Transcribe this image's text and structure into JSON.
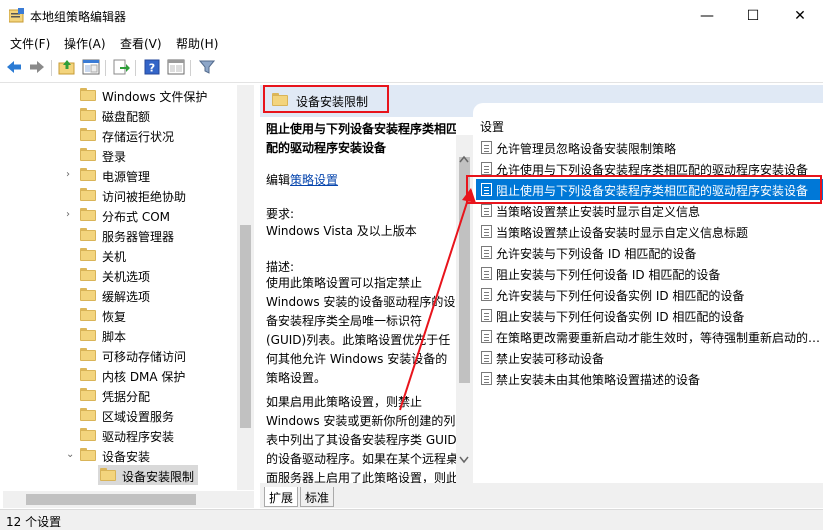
{
  "window": {
    "title": "本地组策略编辑器",
    "minimize_glyph": "—",
    "maximize_glyph": "☐",
    "close_glyph": "✕"
  },
  "menu": {
    "file": "文件(F)",
    "action": "操作(A)",
    "view": "查看(V)",
    "help": "帮助(H)"
  },
  "toolbar": {
    "icons": [
      "back-arrow-icon",
      "forward-arrow-icon",
      "up-folder-icon",
      "show-hide-tree-icon",
      "export-list-icon",
      "help-icon",
      "properties-icon",
      "filter-icon"
    ]
  },
  "tree": {
    "items": [
      {
        "label": "Windows 文件保护",
        "expandable": false
      },
      {
        "label": "磁盘配额",
        "expandable": false
      },
      {
        "label": "存储运行状况",
        "expandable": false
      },
      {
        "label": "登录",
        "expandable": false
      },
      {
        "label": "电源管理",
        "expandable": true
      },
      {
        "label": "访问被拒绝协助",
        "expandable": false
      },
      {
        "label": "分布式 COM",
        "expandable": true
      },
      {
        "label": "服务器管理器",
        "expandable": false
      },
      {
        "label": "关机",
        "expandable": false
      },
      {
        "label": "关机选项",
        "expandable": false
      },
      {
        "label": "缓解选项",
        "expandable": false
      },
      {
        "label": "恢复",
        "expandable": false
      },
      {
        "label": "脚本",
        "expandable": false
      },
      {
        "label": "可移动存储访问",
        "expandable": false
      },
      {
        "label": "内核 DMA 保护",
        "expandable": false
      },
      {
        "label": "凭据分配",
        "expandable": false
      },
      {
        "label": "区域设置服务",
        "expandable": false
      },
      {
        "label": "驱动程序安装",
        "expandable": false
      },
      {
        "label": "设备安装",
        "expandable": true,
        "expanded": true
      },
      {
        "label": "设备安装限制",
        "expandable": false,
        "selected": true
      }
    ]
  },
  "right": {
    "header_label": "设备安装限制",
    "description": {
      "title": "阻止使用与下列设备安装程序类相匹配的驱动程序安装设备",
      "edit_prefix": "编辑",
      "edit_link": "策略设置",
      "requirements_label": "要求:",
      "requirements_value": "Windows Vista 及以上版本",
      "desc_label": "描述:",
      "desc_text": "使用此策略设置可以指定禁止 Windows 安装的设备驱动程序的设备安装程序类全局唯一标识符(GUID)列表。此策略设置优先于任何其他允许 Windows 安装设备的策略设置。",
      "desc_text2": "如果启用此策略设置，则禁止 Windows 安装或更新你所创建的列表中列出了其设备安装程序类 GUID 的设备驱动程序。如果在某个远程桌面服务器上启用了此策略设置，则此策略设置会影响指定设"
    },
    "list_header": "设置",
    "list_items": [
      "允许管理员忽略设备安装限制策略",
      "允许使用与下列设备安装程序类相匹配的驱动程序安装设备",
      "阻止使用与下列设备安装程序类相匹配的驱动程序安装设备",
      "当策略设置禁止安装时显示自定义信息",
      "当策略设置禁止设备安装时显示自定义信息标题",
      "允许安装与下列设备 ID 相匹配的设备",
      "阻止安装与下列任何设备 ID 相匹配的设备",
      "允许安装与下列任何设备实例 ID 相匹配的设备",
      "阻止安装与下列任何设备实例 ID 相匹配的设备",
      "在策略更改需要重新启动才能生效时，等待强制重新启动的…",
      "禁止安装可移动设备",
      "禁止安装未由其他策略设置描述的设备"
    ],
    "tabs": {
      "extended": "扩展",
      "standard": "标准"
    }
  },
  "status": {
    "text": "12 个设置"
  },
  "colors": {
    "selection_blue": "#0078d7",
    "highlight_red": "#e8141c",
    "header_bg": "#e0e9f5"
  }
}
